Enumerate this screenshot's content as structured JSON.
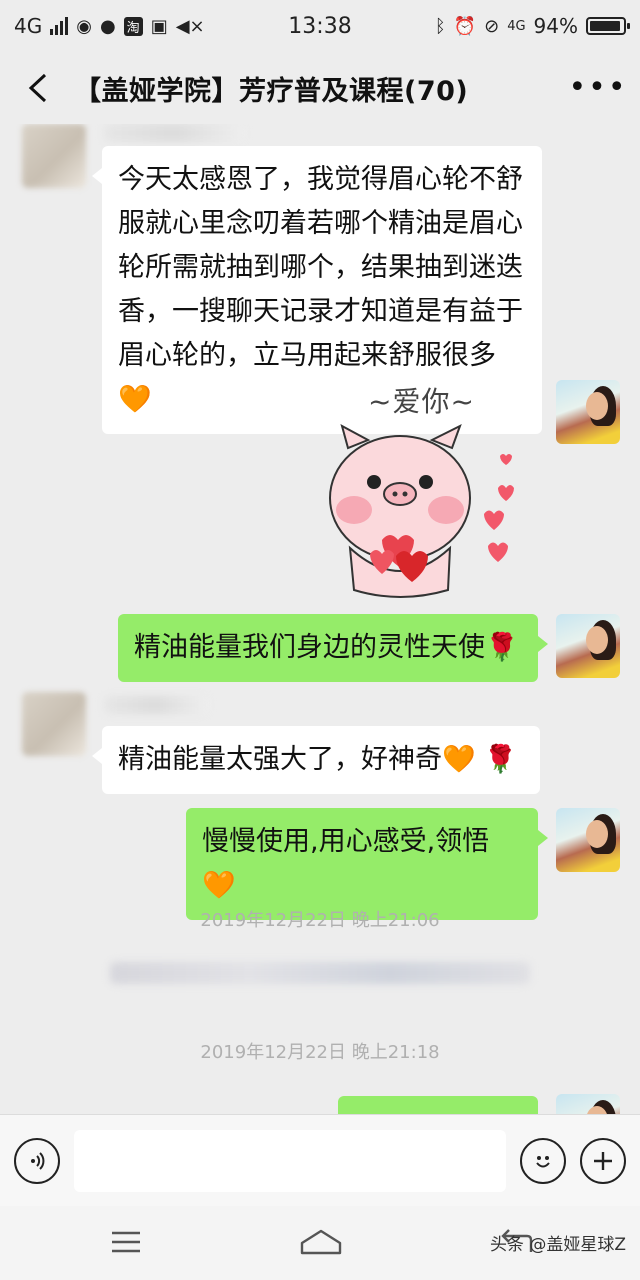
{
  "status_bar": {
    "network": "4G",
    "time": "13:38",
    "network_right": "4G",
    "battery_percent": "94%",
    "battery_level": 0.94,
    "app_icon_text": "淘"
  },
  "header": {
    "title": "【盖娅学院】芳疗普及课程(70)"
  },
  "messages": [
    {
      "side": "left",
      "text": "今天太感恩了，我觉得眉心轮不舒服就心里念叨着若哪个精油是眉心轮所需就抽到哪个，结果抽到迷迭香，一搜聊天记录才知道是有益于眉心轮的，立马用起来舒服很多",
      "emoji": "🧡",
      "emoji2": ""
    },
    {
      "side": "right",
      "type": "sticker",
      "sticker_text": "~爱你~",
      "sticker_name": "pig-love-sticker"
    },
    {
      "side": "right",
      "text": "精油能量我们身边的灵性天使",
      "emoji": "",
      "emoji2": "🌹"
    },
    {
      "side": "left",
      "text": "精油能量太强大了，好神奇",
      "emoji": "🧡",
      "emoji2": "🌹"
    },
    {
      "side": "right",
      "text": "慢慢使用,用心感受,领悟",
      "emoji": "🧡",
      "emoji2": ""
    }
  ],
  "timestamps": [
    "2019年12月22日 晚上21:06",
    "2019年12月22日 晚上21:18"
  ],
  "input_bar": {
    "placeholder": "",
    "value": ""
  },
  "watermark": "头条 @盖娅星球Z",
  "colors": {
    "background": "#ededed",
    "bubble_self": "#95ec69",
    "bubble_other": "#ffffff",
    "timestamp": "#b0b0b0",
    "heart": "#f26b2a"
  }
}
